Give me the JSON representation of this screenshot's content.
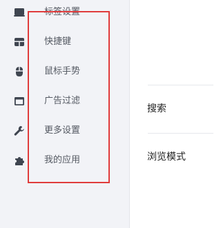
{
  "sidebar": {
    "items": [
      {
        "label": "标签设置",
        "icon": "monitor-icon"
      },
      {
        "label": "快捷键",
        "icon": "layout-grid-icon"
      },
      {
        "label": "鼠标手势",
        "icon": "mouse-icon"
      },
      {
        "label": "广告过滤",
        "icon": "window-icon"
      },
      {
        "label": "更多设置",
        "icon": "wrench-icon"
      },
      {
        "label": "我的应用",
        "icon": "puzzle-icon"
      }
    ]
  },
  "content": {
    "rows": [
      {
        "label": "搜索"
      },
      {
        "label": "浏览模式"
      }
    ]
  },
  "colors": {
    "sidebar_bg": "#f2f3f7",
    "icon": "#3f4550",
    "sidebar_text": "#555a63",
    "highlight": "#e03b3b",
    "content_text": "#222222"
  }
}
